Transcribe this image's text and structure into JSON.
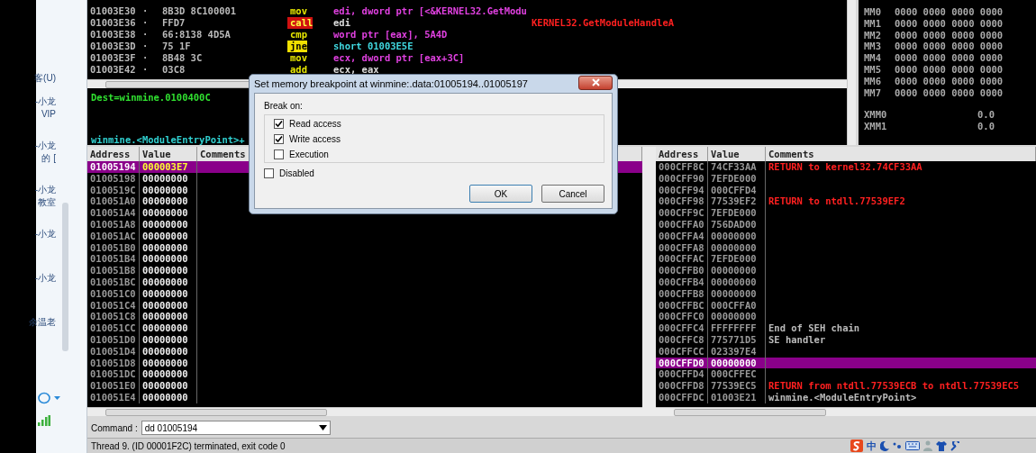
{
  "chat_sidebar": {
    "groups": [
      {
        "lines": [
          "客(U)"
        ]
      },
      {
        "lines": [
          "-小龙",
          "VIP"
        ]
      },
      {
        "lines": [
          "-小龙",
          "的 ["
        ]
      },
      {
        "lines": [
          "-小龙",
          "教室"
        ]
      },
      {
        "lines": [
          "-小龙"
        ]
      },
      {
        "lines": [
          "-小龙"
        ]
      },
      {
        "lines": [
          "余温老"
        ]
      }
    ]
  },
  "disassembly": {
    "rows": [
      {
        "address": "01003E30",
        "mark": "·",
        "hex": "8B3D 8C100001",
        "mnemonic": "mov",
        "kind": "memory",
        "operands": "edi, dword ptr [<&KERNEL32.GetModu"
      },
      {
        "address": "01003E36",
        "mark": "·",
        "hex": "FFD7",
        "mnemonic": "call",
        "kind": "call",
        "operands": "edi",
        "comment": "KERNEL32.GetModuleHandleA"
      },
      {
        "address": "01003E38",
        "mark": "·",
        "hex": "66:8138 4D5A",
        "mnemonic": "cmp",
        "kind": "memory",
        "operands": "word ptr [eax], 5A4D"
      },
      {
        "address": "01003E3D",
        "mark": "·",
        "hex": "75 1F",
        "mnemonic": "jne",
        "kind": "jump",
        "operands": "short 01003E5E"
      },
      {
        "address": "01003E3F",
        "mark": "·",
        "hex": "8B48 3C",
        "mnemonic": "mov",
        "kind": "memory",
        "operands": "ecx, dword ptr [eax+3C]"
      },
      {
        "address": "01003E42",
        "mark": "·",
        "hex": "03C8",
        "mnemonic": "add",
        "kind": "register",
        "operands": "ecx, eax"
      }
    ]
  },
  "info": {
    "lines": [
      {
        "text": "Dest=winmine.0100400C",
        "kind": "dest"
      },
      {
        "text": "winmine.<ModuleEntryPoint>+",
        "kind": "label"
      }
    ]
  },
  "registers": {
    "mmx": [
      {
        "name": "MM0",
        "value": "0000 0000 0000 0000"
      },
      {
        "name": "MM1",
        "value": "0000 0000 0000 0000"
      },
      {
        "name": "MM2",
        "value": "0000 0000 0000 0000"
      },
      {
        "name": "MM3",
        "value": "0000 0000 0000 0000"
      },
      {
        "name": "MM4",
        "value": "0000 0000 0000 0000"
      },
      {
        "name": "MM5",
        "value": "0000 0000 0000 0000"
      },
      {
        "name": "MM6",
        "value": "0000 0000 0000 0000"
      },
      {
        "name": "MM7",
        "value": "0000 0000 0000 0000"
      }
    ],
    "xmm": [
      {
        "name": "XMM0",
        "value": "0.0"
      },
      {
        "name": "XMM1",
        "value": "0.0"
      }
    ]
  },
  "dump": {
    "columns": [
      "Address",
      "Value",
      "Comments"
    ],
    "rows": [
      {
        "address": "01005194",
        "value": "000003E7",
        "selected": true
      },
      {
        "address": "01005198",
        "value": "00000000",
        "selected": false
      },
      {
        "address": "0100519C",
        "value": "00000000",
        "selected": false
      },
      {
        "address": "010051A0",
        "value": "00000000",
        "selected": false
      },
      {
        "address": "010051A4",
        "value": "00000000",
        "selected": false
      },
      {
        "address": "010051A8",
        "value": "00000000",
        "selected": false
      },
      {
        "address": "010051AC",
        "value": "00000000",
        "selected": false
      },
      {
        "address": "010051B0",
        "value": "00000000",
        "selected": false
      },
      {
        "address": "010051B4",
        "value": "00000000",
        "selected": false
      },
      {
        "address": "010051B8",
        "value": "00000000",
        "selected": false
      },
      {
        "address": "010051BC",
        "value": "00000000",
        "selected": false
      },
      {
        "address": "010051C0",
        "value": "00000000",
        "selected": false
      },
      {
        "address": "010051C4",
        "value": "00000000",
        "selected": false
      },
      {
        "address": "010051C8",
        "value": "00000000",
        "selected": false
      },
      {
        "address": "010051CC",
        "value": "00000000",
        "selected": false
      },
      {
        "address": "010051D0",
        "value": "00000000",
        "selected": false
      },
      {
        "address": "010051D4",
        "value": "00000000",
        "selected": false
      },
      {
        "address": "010051D8",
        "value": "00000000",
        "selected": false
      },
      {
        "address": "010051DC",
        "value": "00000000",
        "selected": false
      },
      {
        "address": "010051E0",
        "value": "00000000",
        "selected": false
      },
      {
        "address": "010051E4",
        "value": "00000000",
        "selected": false
      }
    ]
  },
  "stack": {
    "columns": [
      "Address",
      "Value",
      "Comments"
    ],
    "rows": [
      {
        "address": "000CFF8C",
        "value": "74CF33AA",
        "comment": "RETURN to kernel32.74CF33AA",
        "kind": "return",
        "selected": false
      },
      {
        "address": "000CFF90",
        "value": "7EFDE000",
        "selected": false
      },
      {
        "address": "000CFF94",
        "value": "000CFFD4",
        "selected": false
      },
      {
        "address": "000CFF98",
        "value": "77539EF2",
        "comment": "RETURN to ntdll.77539EF2",
        "kind": "return",
        "selected": false
      },
      {
        "address": "000CFF9C",
        "value": "7EFDE000",
        "selected": false
      },
      {
        "address": "000CFFA0",
        "value": "756DAD00",
        "selected": false
      },
      {
        "address": "000CFFA4",
        "value": "00000000",
        "selected": false
      },
      {
        "address": "000CFFA8",
        "value": "00000000",
        "selected": false
      },
      {
        "address": "000CFFAC",
        "value": "7EFDE000",
        "selected": false
      },
      {
        "address": "000CFFB0",
        "value": "00000000",
        "selected": false
      },
      {
        "address": "000CFFB4",
        "value": "00000000",
        "selected": false
      },
      {
        "address": "000CFFB8",
        "value": "00000000",
        "selected": false
      },
      {
        "address": "000CFFBC",
        "value": "000CFFA0",
        "selected": false
      },
      {
        "address": "000CFFC0",
        "value": "00000000",
        "selected": false
      },
      {
        "address": "000CFFC4",
        "value": "FFFFFFFF",
        "comment": "End of SEH chain",
        "kind": "note",
        "selected": false
      },
      {
        "address": "000CFFC8",
        "value": "775771D5",
        "comment": "SE handler",
        "kind": "note",
        "selected": false
      },
      {
        "address": "000CFFCC",
        "value": "023397E4",
        "selected": false
      },
      {
        "address": "000CFFD0",
        "value": "00000000",
        "selected": true
      },
      {
        "address": "000CFFD4",
        "value": "000CFFEC",
        "selected": false
      },
      {
        "address": "000CFFD8",
        "value": "77539EC5",
        "comment": "RETURN from ntdll.77539ECB to ntdll.77539EC5",
        "kind": "return",
        "selected": false
      },
      {
        "address": "000CFFDC",
        "value": "01003E21",
        "comment": "winmine.<ModuleEntryPoint>",
        "kind": "note",
        "selected": false
      }
    ]
  },
  "dialog": {
    "title": "Set memory breakpoint at winmine:.data:01005194..01005197",
    "group_label": "Break on:",
    "options": [
      {
        "label": "Read access",
        "checked": true
      },
      {
        "label": "Write access",
        "checked": true
      },
      {
        "label": "Execution",
        "checked": false
      }
    ],
    "disabled": {
      "label": "Disabled",
      "checked": false
    },
    "buttons": [
      {
        "label": "OK",
        "default": true
      },
      {
        "label": "Cancel",
        "default": false
      }
    ]
  },
  "command": {
    "label": "Command :",
    "value": "dd 01005194"
  },
  "status_bar": {
    "text": "Thread 9. (ID 00001F2C) terminated, exit code 0"
  },
  "tray": {
    "ime_label": "中"
  }
}
